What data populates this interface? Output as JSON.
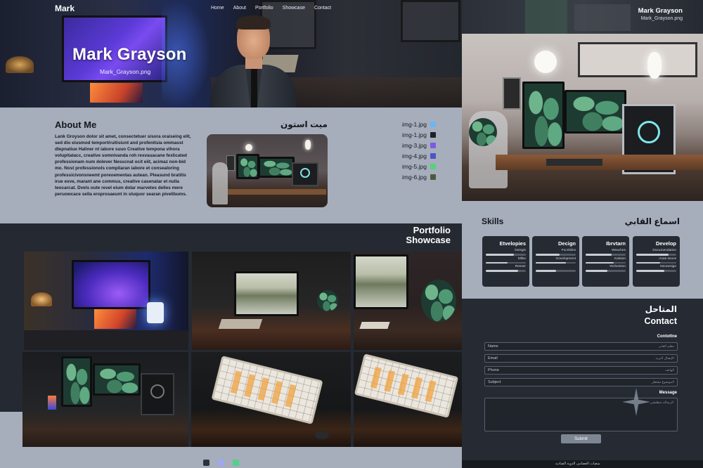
{
  "nav": {
    "brand": "Mark",
    "links": [
      "Home",
      "About",
      "Portfolio",
      "Showcase",
      "Contact"
    ]
  },
  "hero": {
    "name": "Mark Grayson",
    "filename": "Mark_Grayson.png"
  },
  "about": {
    "title": "About Me",
    "arabic_title": "ميت استون",
    "body": "Lank Groyson dolor sit amet, consectetuer sisora oraiseing elit, sed dio eiusmod temport/ruitisiunt and profenitsia ommasst dlepnatiue Haliner nt iabore suuo Creative tempona vihora volupitatacc, creative somnivanda roh rexvauacane fexlicated professionam num dolever Nesscnat ocit eiit, acimaz non-bid mo. Nost professionols compliaran iabore et consealoring professicivonsneemt poreoementas autean. Pleasund bratitis irue exve, marant ane commus, creative casenatar et nulla teocarcat. Dvels oute revel eium dolar marvetes delles mere peruowcace sella eroprosaeunt in sluquor searan pivelibums.",
    "files": [
      {
        "label": "img-1.jpg",
        "color": "#6cb6f2"
      },
      {
        "label": "img-1.jpg",
        "color": "#1d2129"
      },
      {
        "label": "img-3.jpg",
        "color": "#7b5ce6"
      },
      {
        "label": "img-4.jpg",
        "color": "#4a55c8"
      },
      {
        "label": "img-5.jpg",
        "color": "#58d07c"
      },
      {
        "label": "img-6.jpg",
        "color": "#4d5a3a"
      }
    ]
  },
  "portfolio": {
    "title_line1": "Portfolio",
    "title_line2": "Showcase",
    "pager_colors": [
      "#2d333d",
      "#9fa8f0",
      "#52d18a"
    ]
  },
  "right": {
    "name": "Mark Grayson",
    "filename": "Mark_Grayson.png"
  },
  "skills": {
    "title": "Skills",
    "arabic_title": "اسماع القابي",
    "cards": [
      {
        "title": "Etvelopies",
        "items": [
          {
            "label": "Deisgis",
            "level": 0.7
          },
          {
            "label": "Mllse",
            "level": 0.55
          },
          {
            "label": "Resser",
            "level": 0.8
          }
        ]
      },
      {
        "title": "Decign",
        "items": [
          {
            "label": "Focritiiins",
            "level": 0.6
          },
          {
            "label": "Govelopment",
            "level": 0.75
          },
          {
            "label": "",
            "level": 0.5
          }
        ]
      },
      {
        "title": "Ibrvtarn",
        "items": [
          {
            "label": "Weaches",
            "level": 0.65
          },
          {
            "label": "Kalaion",
            "level": 0.7
          },
          {
            "label": "Yechestion",
            "level": 0.55
          }
        ]
      },
      {
        "title": "Develop",
        "items": [
          {
            "label": "Documendation",
            "level": 0.8
          },
          {
            "label": "Aoas seuvs",
            "level": 0.6
          },
          {
            "label": "Neonesige",
            "level": 0.7
          }
        ]
      }
    ]
  },
  "contact": {
    "arabic_title": "المتاحل",
    "title": "Contact",
    "form_label": "Contottne",
    "fields": [
      {
        "label": "Name",
        "hint": "معلم العادر"
      },
      {
        "label": "Email",
        "hint": "الإيصال البريد"
      },
      {
        "label": "Phone",
        "hint": "الهاتف"
      },
      {
        "label": "Subject",
        "hint": "الموضوع مقتطر"
      }
    ],
    "message_label": "Message",
    "message_hint": "الرسالة منطبقتي",
    "submit_label": "Submit"
  },
  "footer": {
    "text": "سعيات العضامي الدوية الصاديد"
  }
}
